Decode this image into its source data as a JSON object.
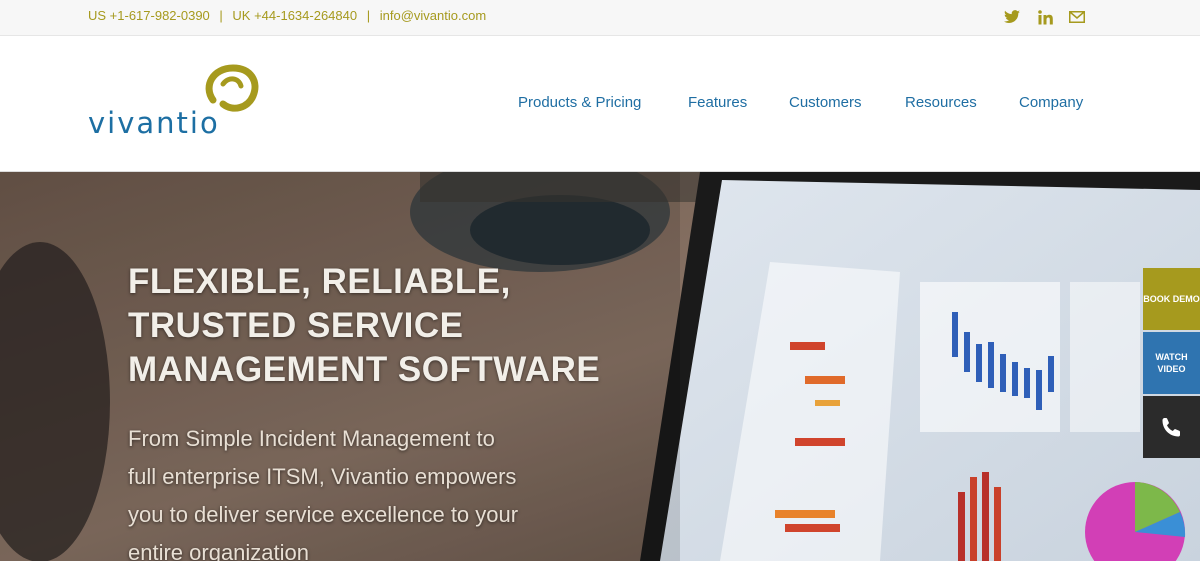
{
  "topbar": {
    "us_phone": "US +1-617-982-0390",
    "uk_phone": "UK +44-1634-264840",
    "email": "info@vivantio.com",
    "separator": "|",
    "social_icons": [
      "twitter-icon",
      "linkedin-icon",
      "mail-icon"
    ]
  },
  "header": {
    "logo_text": "vivantio",
    "nav": [
      {
        "label": "Products & Pricing"
      },
      {
        "label": "Features"
      },
      {
        "label": "Customers"
      },
      {
        "label": "Resources"
      },
      {
        "label": "Company"
      }
    ]
  },
  "hero": {
    "title_lines": [
      "FLEXIBLE, RELIABLE,",
      "TRUSTED SERVICE",
      "MANAGEMENT SOFTWARE"
    ],
    "subtitle_lines": [
      "From Simple Incident Management to",
      "full enterprise ITSM, Vivantio empowers",
      "you to deliver service excellence to your",
      "entire organization"
    ]
  },
  "side_tabs": {
    "demo_label": "BOOK DEMO",
    "video_label": "WATCH VIDEO",
    "phone_icon": "phone-icon"
  },
  "colors": {
    "accent": "#a69a1e",
    "brand_blue": "#1f6ea3",
    "video_tab": "#2f74b0",
    "phone_tab": "#2b2b2b"
  }
}
